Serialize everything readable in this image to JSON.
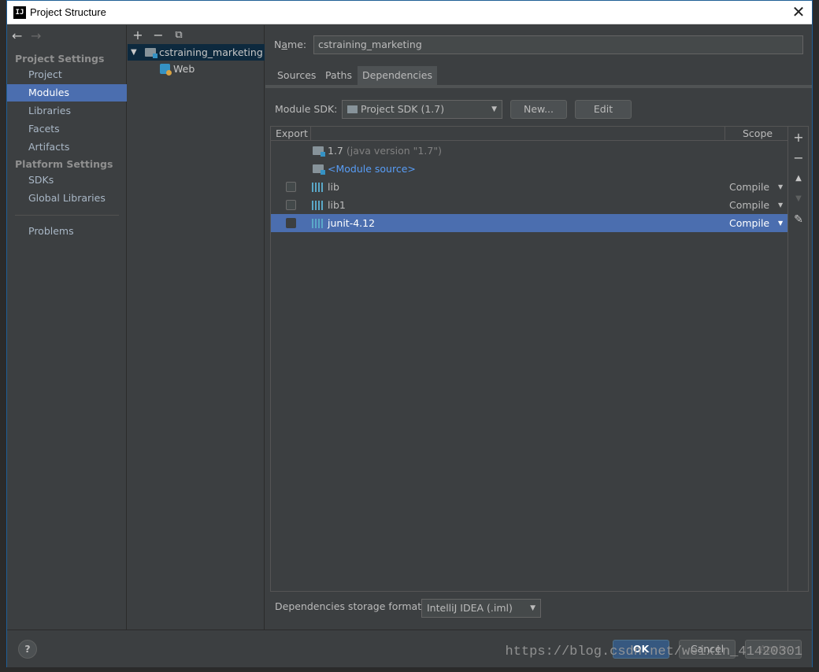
{
  "window": {
    "title": "Project Structure",
    "app_icon_text": "IJ",
    "close_glyph": "✕"
  },
  "nav": {
    "back_glyph": "←",
    "forward_glyph": "→",
    "section_project": "Project Settings",
    "items_project": [
      "Project",
      "Modules",
      "Libraries",
      "Facets",
      "Artifacts"
    ],
    "section_platform": "Platform Settings",
    "items_platform": [
      "SDKs",
      "Global Libraries"
    ],
    "problems": "Problems",
    "selected": "Modules"
  },
  "tree": {
    "toolbar": {
      "add": "+",
      "remove": "−",
      "copy": "⧉"
    },
    "module": "cstraining_marketing",
    "facet": "Web",
    "expand_glyph": "▼"
  },
  "main": {
    "name_label": "Name:",
    "name_value": "cstraining_marketing",
    "tabs": [
      "Sources",
      "Paths",
      "Dependencies"
    ],
    "active_tab": "Dependencies",
    "sdk_label": "Module SDK:",
    "sdk_value": "Project SDK (1.7)",
    "new_button": "New...",
    "edit_button": "Edit",
    "table": {
      "header_export": "Export",
      "header_scope": "Scope",
      "rows": [
        {
          "name": "1.7",
          "suffix": "(java version \"1.7\")",
          "kind": "sdk",
          "checkbox": false,
          "scope": ""
        },
        {
          "name": "<Module source>",
          "suffix": "",
          "kind": "source",
          "checkbox": false,
          "scope": ""
        },
        {
          "name": "lib",
          "suffix": "",
          "kind": "library",
          "checkbox": true,
          "scope": "Compile"
        },
        {
          "name": "lib1",
          "suffix": "",
          "kind": "library",
          "checkbox": true,
          "scope": "Compile"
        },
        {
          "name": "junit-4.12",
          "suffix": "",
          "kind": "library",
          "checkbox": true,
          "scope": "Compile",
          "selected": true
        }
      ]
    },
    "side_tools": {
      "add": "+",
      "remove": "−",
      "up": "▲",
      "down": "▼",
      "edit": "✎"
    },
    "storage_label": "Dependencies storage format:",
    "storage_value": "IntelliJ IDEA (.iml)"
  },
  "footer": {
    "help": "?",
    "ok": "OK",
    "cancel": "Cancel",
    "apply": "Apply",
    "watermark": "https://blog.csdn.net/weixin_41420301"
  },
  "colors": {
    "selection": "#4b6eaf",
    "link": "#589df6",
    "panel_bg": "#3c3f41"
  }
}
